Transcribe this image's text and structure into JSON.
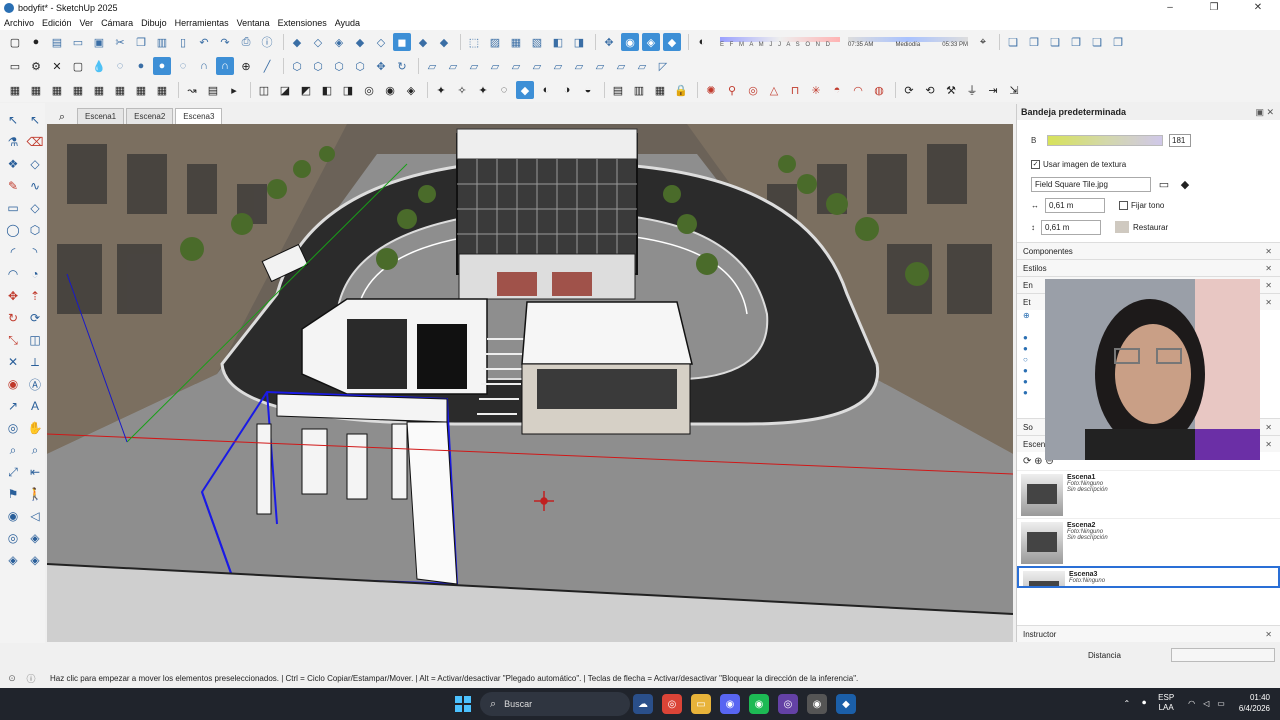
{
  "window": {
    "title": "bodyfit* - SketchUp 2025",
    "controls": [
      "–",
      "❐",
      "✕"
    ]
  },
  "menu": [
    "Archivo",
    "Edición",
    "Ver",
    "Cámara",
    "Dibujo",
    "Herramientas",
    "Ventana",
    "Extensiones",
    "Ayuda"
  ],
  "shadow": {
    "months": "E F M A M J J A S O N D",
    "time_start": "07:35 AM",
    "time_mid": "Mediodía",
    "time_end": "05:33 PM"
  },
  "scene_tabs": [
    "Escena1",
    "Escena2",
    "Escena3"
  ],
  "active_scene_tab": "Escena3",
  "tray": {
    "title": "Bandeja predeterminada",
    "color_b_label": "B",
    "color_b_value": "181",
    "use_texture_label": "Usar imagen de textura",
    "texture_file": "Field Square Tile.jpg",
    "width_value": "0,61 m",
    "height_value": "0,61 m",
    "fix_tone_label": "Fijar tono",
    "restore_label": "Restaurar",
    "sections": {
      "components": "Componentes",
      "styles": "Estilos",
      "en_partial": "En",
      "et_partial": "Et",
      "so_partial": "So",
      "scenes": "Escenas",
      "instructor": "Instructor"
    },
    "scenes": [
      {
        "name": "Escena1",
        "photo": "Foto:",
        "photo_value": "Ninguno",
        "desc": "Sin descripción"
      },
      {
        "name": "Escena2",
        "photo": "Foto:",
        "photo_value": "Ninguno",
        "desc": "Sin descripción"
      },
      {
        "name": "Escena3",
        "photo": "Foto:",
        "photo_value": "Ninguno",
        "desc": ""
      }
    ]
  },
  "measurement": {
    "label": "Distancia",
    "value": ""
  },
  "status_message": "Haz clic para empezar a mover los elementos preseleccionados. | Ctrl = Ciclo Copiar/Estampar/Mover. | Alt = Activar/desactivar \"Plegado automático\". | Teclas de flecha = Activar/desactivar \"Bloquear la dirección de la inferencia\".",
  "taskbar": {
    "search_placeholder": "Buscar",
    "lang_top": "ESP",
    "lang_bottom": "LAA",
    "time": "01:40",
    "date": "6/4/2026"
  },
  "viewport": {
    "storefront_left": "",
    "storefront_right": ""
  },
  "colors": {
    "accent": "#3d8fd6",
    "selection": "#1a1ae6",
    "axis_red": "#d01818",
    "axis_green": "#18a018",
    "axis_blue": "#1818c8",
    "road": "#2b2b2b",
    "sidewalk": "#8e8e8e"
  }
}
